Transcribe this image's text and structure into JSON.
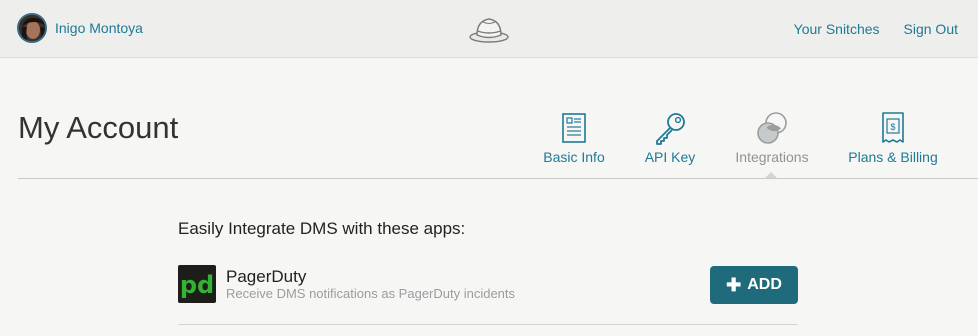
{
  "user": {
    "name": "Inigo Montoya"
  },
  "topnav": {
    "your_snitches": "Your Snitches",
    "sign_out": "Sign Out"
  },
  "page": {
    "title": "My Account"
  },
  "tabs": [
    {
      "label": "Basic Info",
      "icon": "document-icon",
      "active": false
    },
    {
      "label": "API Key",
      "icon": "key-icon",
      "active": false
    },
    {
      "label": "Integrations",
      "icon": "integrations-icon",
      "active": true
    },
    {
      "label": "Plans & Billing",
      "icon": "receipt-icon",
      "active": false
    }
  ],
  "integrations": {
    "heading": "Easily Integrate DMS with these apps:",
    "items": [
      {
        "name": "PagerDuty",
        "description": "Receive DMS notifications as PagerDuty incidents",
        "logo_text": "pd",
        "button_label": "ADD"
      }
    ]
  },
  "colors": {
    "link": "#207a96",
    "button": "#1f6b7c",
    "pagerduty_green": "#34b233",
    "muted": "#9a9d9e"
  }
}
